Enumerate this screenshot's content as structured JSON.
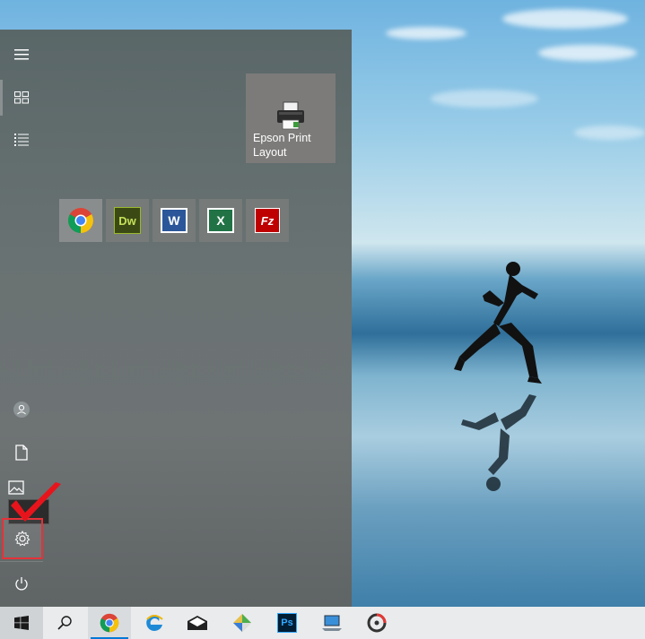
{
  "start_menu": {
    "tiles": {
      "epson": {
        "label": "Epson Print Layout"
      },
      "chrome": {
        "label": "Google Chrome"
      },
      "dreamweaver": {
        "label": "Dw"
      },
      "word": {
        "label": "W"
      },
      "excel": {
        "label": "X"
      },
      "filezilla": {
        "label": "Fz"
      }
    },
    "rail": {
      "expand_icon": "hamburger-icon",
      "tiles_icon": "tiles-icon",
      "all_apps_icon": "list-icon",
      "user_icon": "user-icon",
      "documents_icon": "document-icon",
      "pictures_icon": "picture-icon",
      "settings_icon": "gear-icon",
      "power_icon": "power-icon"
    }
  },
  "taskbar": {
    "items": [
      "windows-start-icon",
      "search-icon",
      "chrome-icon",
      "edge-icon",
      "mail-icon",
      "app-icon",
      "photoshop-icon",
      "device-icon",
      "disk-icon"
    ],
    "photoshop_label": "Ps"
  },
  "colors": {
    "accent": "#0078d7",
    "highlight": "#e53238"
  }
}
